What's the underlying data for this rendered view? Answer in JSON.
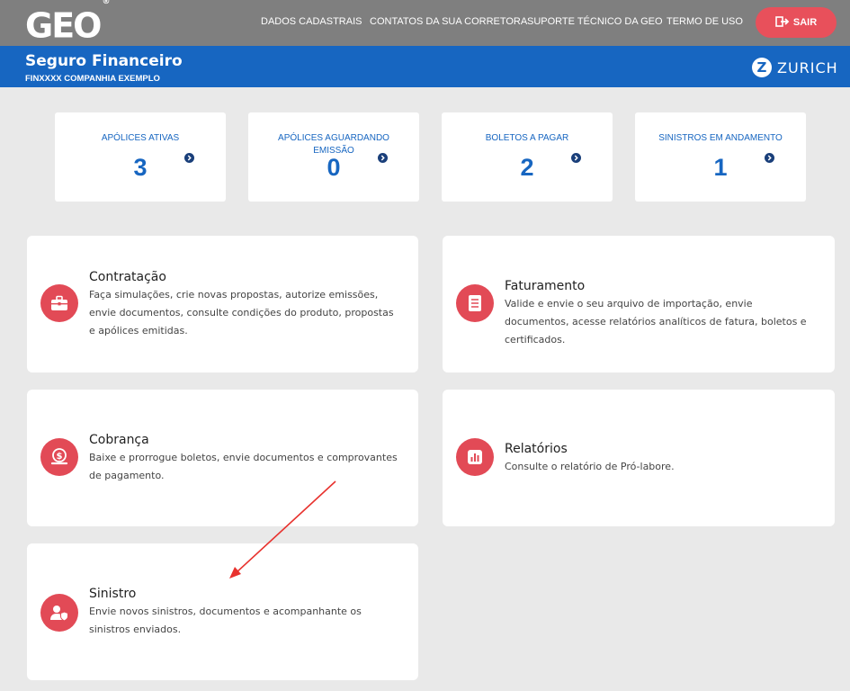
{
  "header": {
    "logo": "GEO",
    "logo_mark": "®",
    "nav": [
      "DADOS CADASTRAIS",
      "CONTATOS DA SUA CORRETORA",
      "SUPORTE TÉCNICO DA GEO",
      "TERMO DE USO"
    ],
    "logout_label": "SAIR"
  },
  "product_bar": {
    "title": "Seguro Financeiro",
    "subtitle": "FINXXXX COMPANHIA EXEMPLO",
    "partner": "ZURICH",
    "partner_mark": "Z"
  },
  "stats": [
    {
      "label": "APÓLICES ATIVAS",
      "value": "3"
    },
    {
      "label": "APÓLICES AGUARDANDO EMISSÃO",
      "value": "0"
    },
    {
      "label": "BOLETOS A PAGAR",
      "value": "2"
    },
    {
      "label": "SINISTROS EM ANDAMENTO",
      "value": "1"
    }
  ],
  "cards": [
    {
      "title": "Contratação",
      "description": "Faça simulações, crie novas propostas, autorize emissões, envie documentos, consulte condições do produto, propostas e apólices emitidas.",
      "icon": "briefcase-icon"
    },
    {
      "title": "Faturamento",
      "description": "Valide e envie o seu arquivo de importação, envie documentos, acesse relatórios analíticos de fatura, boletos e certificados.",
      "icon": "document-icon"
    },
    {
      "title": "Cobrança",
      "description": "Baixe e prorrogue boletos, envie documentos e comprovantes de pagamento.",
      "icon": "money-bag-icon"
    },
    {
      "title": "Relatórios",
      "description": "Consulte o relatório de Pró-labore.",
      "icon": "bar-chart-icon"
    },
    {
      "title": "Sinistro",
      "description": "Envie novos sinistros, documentos e acompanhante os sinistros enviados.",
      "icon": "user-shield-icon"
    }
  ],
  "colors": {
    "topbar": "#7f7f7f",
    "brand_blue": "#1766c1",
    "accent_red": "#e24a56",
    "background": "#e9e9e9",
    "annotation_arrow": "#e8322e"
  }
}
